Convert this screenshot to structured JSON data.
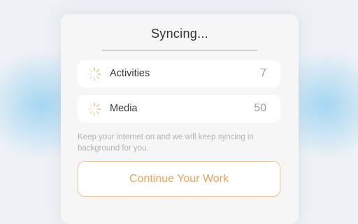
{
  "dialog": {
    "title": "Syncing...",
    "items": [
      {
        "label": "Activities",
        "count": "7",
        "icon": "loading-spinner-icon"
      },
      {
        "label": "Media",
        "count": "50",
        "icon": "loading-spinner-icon"
      }
    ],
    "hint": "Keep your internet on and we will keep syncing in background for you.",
    "button_label": "Continue Your Work"
  },
  "colors": {
    "accent": "#e9a35a",
    "accent_border": "#f0c38c",
    "spinner": "#e6b878",
    "background_glow": "#8ccdf0"
  }
}
